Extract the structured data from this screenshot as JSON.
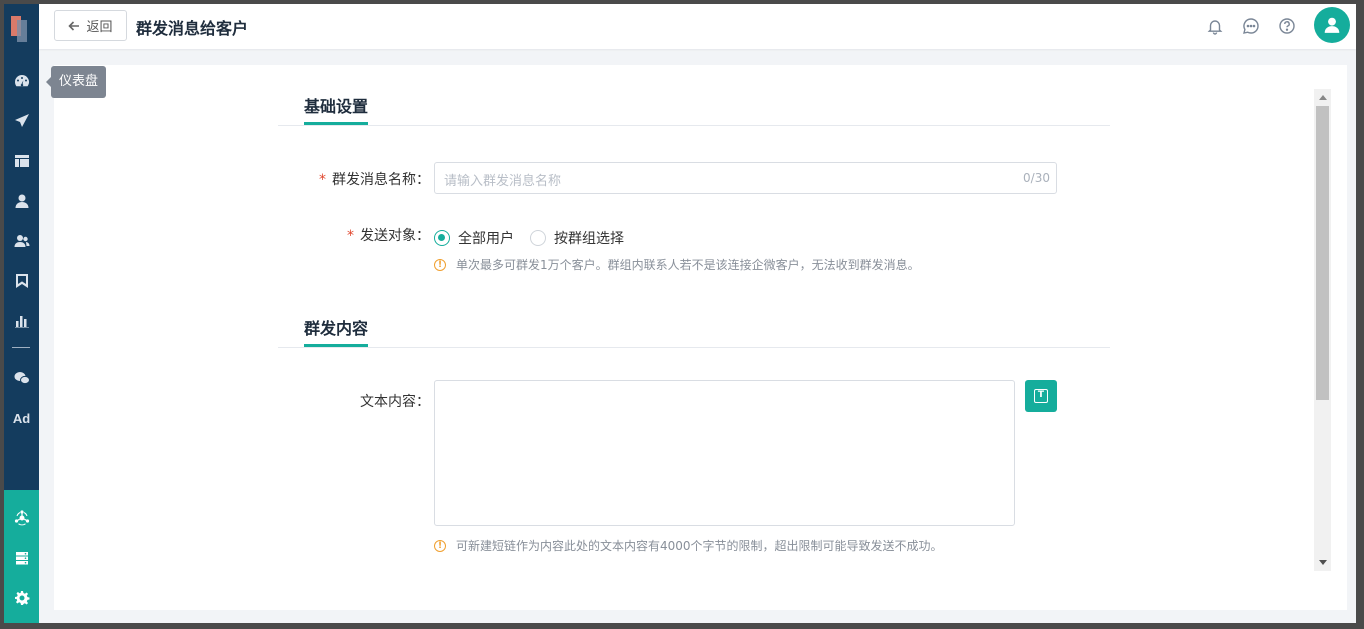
{
  "tooltip": "仪表盘",
  "header": {
    "back_label": "返回",
    "title": "群发消息给客户"
  },
  "sections": {
    "basic": "基础设置",
    "content": "群发内容"
  },
  "form": {
    "name_label": "群发消息名称：",
    "name_placeholder": "请输入群发消息名称",
    "name_count": "0/30",
    "target_label": "发送对象：",
    "target_options": [
      "全部用户",
      "按群组选择"
    ],
    "target_selected": "全部用户",
    "target_hint": "单次最多可群发1万个客户。群组内联系人若不是该连接企微客户，无法收到群发消息。",
    "text_label": "文本内容：",
    "text_hint": "可新建短链作为内容此处的文本内容有4000个字节的限制，超出限制可能导致发送不成功。",
    "required_mark": "*",
    "text_button_glyph": "T",
    "warn_glyph": "!"
  },
  "sidebar": {
    "items": [
      "dashboard-icon",
      "send-icon",
      "layout-icon",
      "user-icon",
      "users-icon",
      "bookmark-icon",
      "chart-icon",
      "wechat-icon",
      "ad-icon"
    ],
    "ad_label": "Ad",
    "bottom_items": [
      "network-icon",
      "server-icon",
      "gear-icon"
    ]
  },
  "colors": {
    "accent": "#15ad9c",
    "sidebar": "#143c5e",
    "required": "#e0462d",
    "warning": "#f0a030"
  }
}
